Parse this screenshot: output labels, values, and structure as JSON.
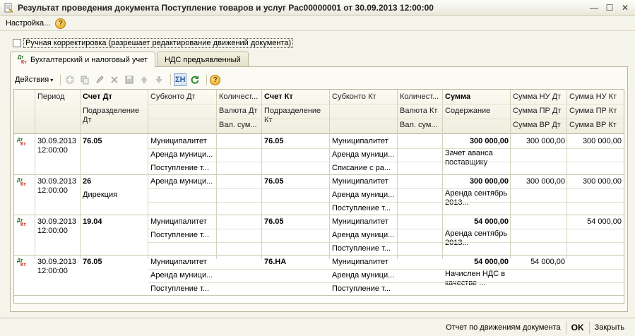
{
  "window": {
    "title": "Результат проведения документа Поступление товаров и услуг Рас00000001 от 30.09.2013 12:00:00",
    "minimize": "—",
    "maximize": "☐",
    "close": "✕"
  },
  "menu": {
    "settings": "Настройка...",
    "help": "?"
  },
  "manual_checkbox": {
    "label": "Ручная корректировка (разрешает редактирование движений документа)",
    "checked": false
  },
  "tabs": [
    {
      "label": "Бухгалтерский и налоговый учет",
      "active": true
    },
    {
      "label": "НДС предъявленный",
      "active": false
    }
  ],
  "toolbar": {
    "actions": "Действия",
    "caret": "▾",
    "sum_label": "ΣН",
    "help": "?"
  },
  "icon_letters": {
    "dt": "Дт",
    "kt": "Кт"
  },
  "columns": {
    "period": "Период",
    "schet_dt": "Счет Дт",
    "subkonto_dt": "Субконто Дт",
    "kolichestvo_dt": "Количест...",
    "schet_kt": "Счет Кт",
    "subkonto_kt": "Субконто Кт",
    "kolichestvo_kt": "Количест...",
    "summa": "Сумма",
    "summa_nu_dt": "Сумма НУ Дт",
    "summa_nu_kt": "Сумма НУ Кт",
    "podrazdelenie_dt": "Подразделение Дт",
    "valyuta_dt": "Валюта Дт",
    "podrazdelenie_kt": "Подразделение Кт",
    "valyuta_kt": "Валюта Кт",
    "soderzhanie": "Содержание",
    "summa_pr_dt": "Сумма ПР Дт",
    "summa_pr_kt": "Сумма ПР Кт",
    "val_sum_dt": "Вал. сум...",
    "val_sum_kt": "Вал. сум...",
    "summa_vr_dt": "Сумма ВР Дт",
    "summa_vr_kt": "Сумма ВР Кт"
  },
  "rows": [
    {
      "date": "30.09.2013",
      "time": "12:00:00",
      "schet_dt": "76.05",
      "podr_dt": "",
      "subkonto_dt": [
        "Муниципалитет",
        "Аренда муници...",
        "Поступление т..."
      ],
      "schet_kt": "76.05",
      "subkonto_kt": [
        "Муниципалитет",
        "Аренда муници...",
        "Списание с ра..."
      ],
      "summa": "300 000,00",
      "soderzhanie": "Зачет аванса поставщику",
      "nu_dt": "300 000,00",
      "nu_kt": "300 000,00"
    },
    {
      "date": "30.09.2013",
      "time": "12:00:00",
      "schet_dt": "26",
      "podr_dt": "Дирекция",
      "subkonto_dt": [
        "Аренда муници...",
        "",
        ""
      ],
      "schet_kt": "76.05",
      "subkonto_kt": [
        "Муниципалитет",
        "Аренда муници...",
        "Поступление т..."
      ],
      "summa": "300 000,00",
      "soderzhanie": "Аренда сентябрь 2013...",
      "nu_dt": "300 000,00",
      "nu_kt": "300 000,00"
    },
    {
      "date": "30.09.2013",
      "time": "12:00:00",
      "schet_dt": "19.04",
      "podr_dt": "",
      "subkonto_dt": [
        "Муниципалитет",
        "Поступление т...",
        ""
      ],
      "schet_kt": "76.05",
      "subkonto_kt": [
        "Муниципалитет",
        "Аренда муници...",
        "Поступление т..."
      ],
      "summa": "54 000,00",
      "soderzhanie": "Аренда сентябрь 2013...",
      "nu_dt": "",
      "nu_kt": "54 000,00"
    },
    {
      "date": "30.09.2013",
      "time": "12:00:00",
      "schet_dt": "76.05",
      "podr_dt": "",
      "subkonto_dt": [
        "Муниципалитет",
        "Аренда муници...",
        "Поступление т..."
      ],
      "schet_kt": "76.НА",
      "subkonto_kt": [
        "Муниципалитет",
        "Аренда муници...",
        "Поступление т..."
      ],
      "summa": "54 000,00",
      "soderzhanie": "Начислен НДС в качестве ...",
      "nu_dt": "54 000,00",
      "nu_kt": ""
    }
  ],
  "status": {
    "report": "Отчет по движениям документа",
    "ok": "OK",
    "close": "Закрыть"
  }
}
